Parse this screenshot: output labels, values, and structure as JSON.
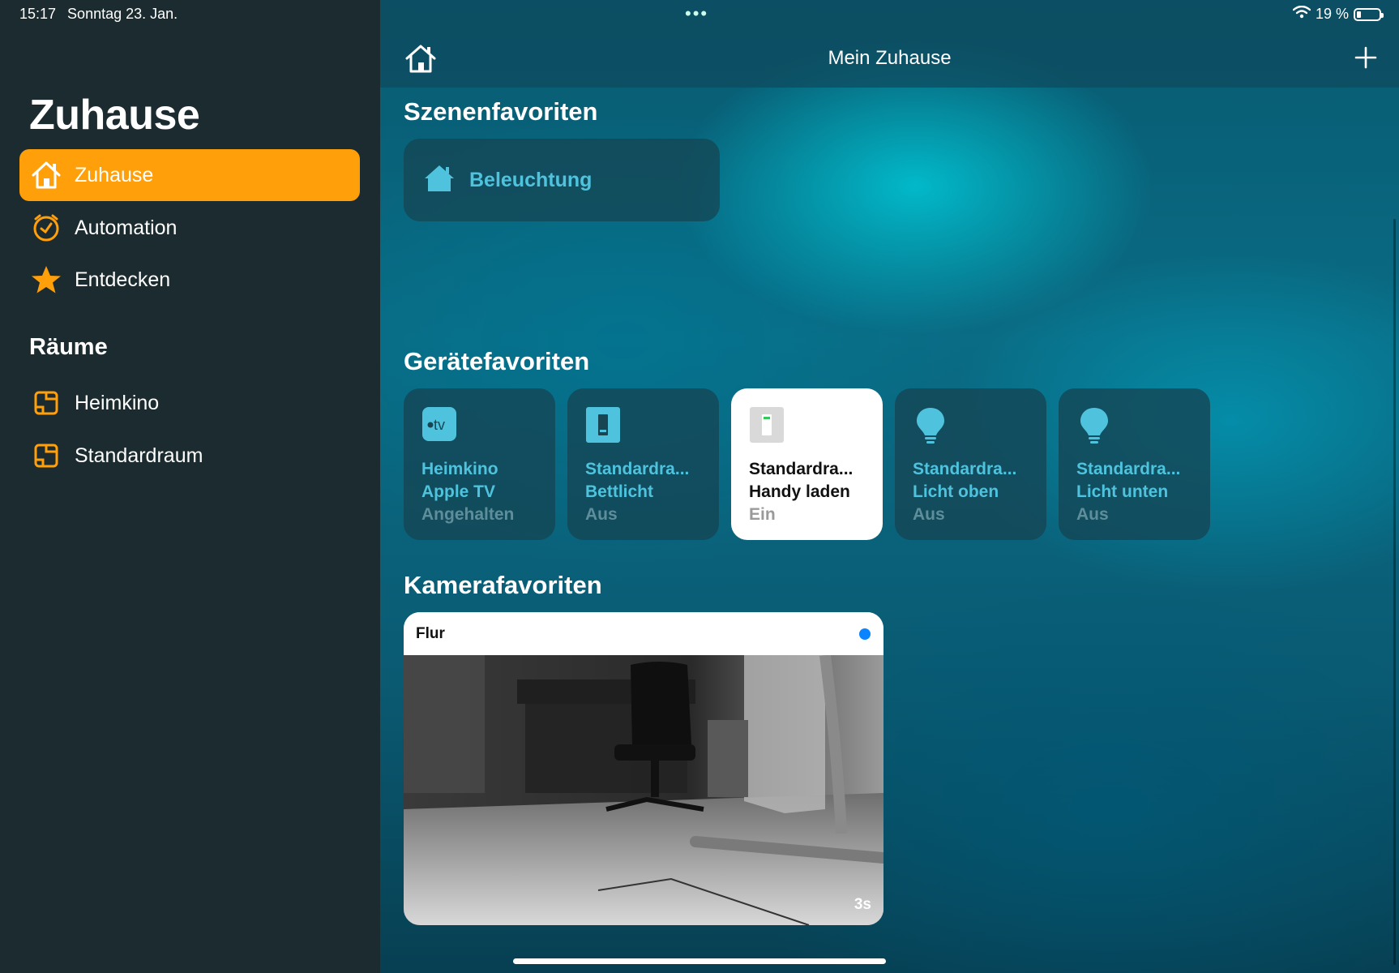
{
  "status": {
    "time": "15:17",
    "date": "Sonntag 23. Jan.",
    "battery": "19 %",
    "battery_level": 0.19
  },
  "sidebar": {
    "title": "Zuhause",
    "nav": [
      {
        "label": "Zuhause",
        "icon": "home-icon",
        "active": true
      },
      {
        "label": "Automation",
        "icon": "clock-icon",
        "active": false
      },
      {
        "label": "Entdecken",
        "icon": "star-icon",
        "active": false
      }
    ],
    "rooms_heading": "Räume",
    "rooms": [
      {
        "label": "Heimkino",
        "icon": "room-icon"
      },
      {
        "label": "Standardraum",
        "icon": "room-icon"
      }
    ]
  },
  "main": {
    "title": "Mein Zuhause",
    "scenes": {
      "heading": "Szenenfavoriten",
      "items": [
        {
          "label": "Beleuchtung",
          "icon": "house-scene-icon"
        }
      ]
    },
    "accessories": {
      "heading": "Gerätefavoriten",
      "items": [
        {
          "line1": "Heimkino",
          "line2": "Apple TV",
          "status": "Angehalten",
          "icon": "apple-tv-icon",
          "on": false
        },
        {
          "line1": "Standardra...",
          "line2": "Bettlicht",
          "status": "Aus",
          "icon": "switch-icon",
          "on": false
        },
        {
          "line1": "Standardra...",
          "line2": "Handy laden",
          "status": "Ein",
          "icon": "switch-icon",
          "on": true
        },
        {
          "line1": "Standardra...",
          "line2": "Licht oben",
          "status": "Aus",
          "icon": "bulb-icon",
          "on": false
        },
        {
          "line1": "Standardra...",
          "line2": "Licht unten",
          "status": "Aus",
          "icon": "bulb-icon",
          "on": false
        }
      ]
    },
    "cameras": {
      "heading": "Kamerafavoriten",
      "items": [
        {
          "name": "Flur",
          "age": "3s"
        }
      ]
    }
  },
  "colors": {
    "accent": "#ff9f0a",
    "tile_text": "#4fc3dd",
    "sidebar_bg": "#1b2b30",
    "live_dot": "#0a84ff"
  }
}
